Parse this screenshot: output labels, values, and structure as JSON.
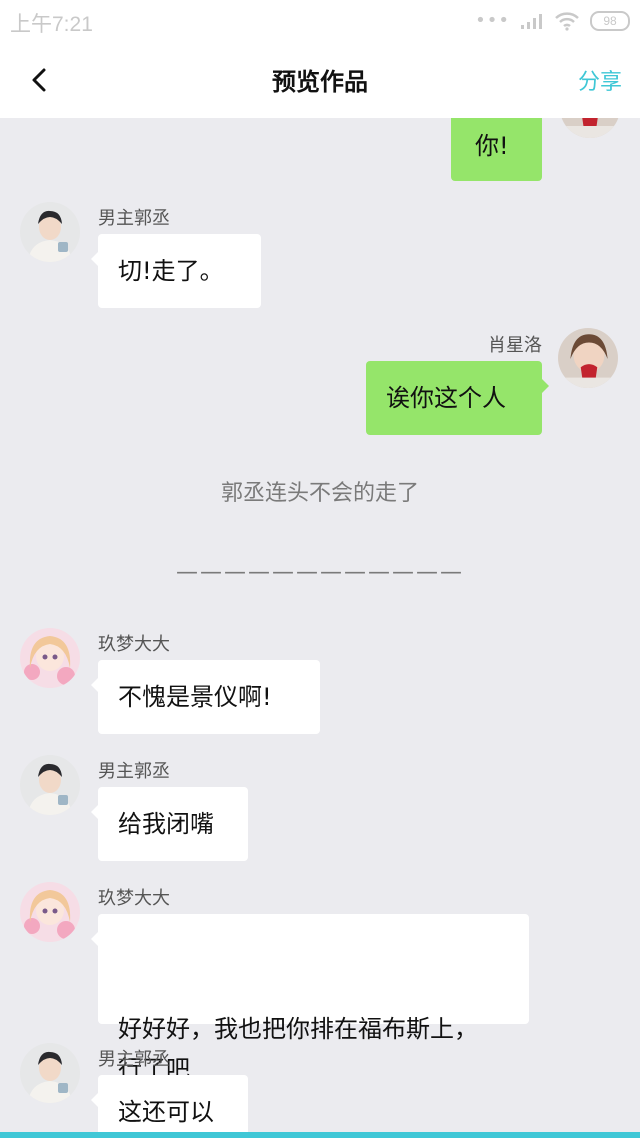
{
  "status_bar": {
    "time": "上午7:21",
    "signal_dots": "•••",
    "battery": "98"
  },
  "header": {
    "title": "预览作品",
    "share_label": "分享"
  },
  "messages": [
    {
      "text": "你!"
    },
    {
      "sender": "男主郭丞",
      "text": "切!走了。"
    },
    {
      "sender": "肖星洛",
      "text": "诶你这个人"
    },
    {
      "text": "郭丞连头不会的走了"
    },
    {
      "text": "————————————"
    },
    {
      "sender": "玖梦大大",
      "text": "不愧是景仪啊!"
    },
    {
      "sender": "男主郭丞",
      "text": "给我闭嘴"
    },
    {
      "sender": "玖梦大大",
      "text": "好好好，我也把你排在福布斯上，\n行了吧"
    },
    {
      "sender": "男主郭丞",
      "text": "这还可以"
    }
  ],
  "colors": {
    "accent": "#3fc7d6",
    "my_bubble": "#95e56a",
    "their_bubble": "#ffffff",
    "background": "#ebebef"
  },
  "icons": [
    "back-chevron-icon",
    "wifi-icon",
    "signal-icon",
    "battery-icon",
    "avatar-girl-heart",
    "avatar-boy",
    "avatar-anime-girl"
  ]
}
